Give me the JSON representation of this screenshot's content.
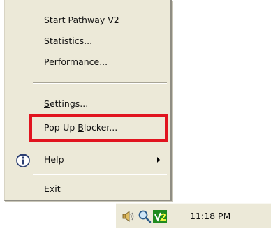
{
  "context_menu": {
    "items": [
      {
        "label": "Start Pathway V2",
        "ul": "",
        "rest": ""
      },
      {
        "pre": "S",
        "ul": "t",
        "rest": "atistics..."
      },
      {
        "pre": "",
        "ul": "P",
        "rest": "erformance..."
      },
      {
        "pre": "",
        "ul": "S",
        "rest": "ettings..."
      },
      {
        "pre": "Pop-Up ",
        "ul": "B",
        "rest": "locker..."
      },
      {
        "label": "Help"
      },
      {
        "label": "Exit"
      }
    ],
    "highlighted_item": "Pop-Up Blocker..."
  },
  "tray": {
    "icons": [
      "speaker-icon",
      "magnifier-icon",
      "pathway-v2-icon"
    ],
    "clock": "11:18 PM"
  },
  "colors": {
    "menu_background": "#ece9d8",
    "highlight_border": "#e1141f",
    "pathway_green": "#1f8b1f"
  }
}
